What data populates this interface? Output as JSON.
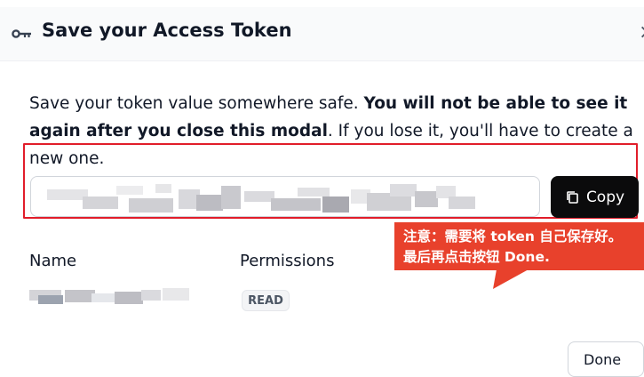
{
  "modal": {
    "title": "Save your Access Token",
    "key_icon": "key-icon",
    "close_icon": "close-icon",
    "close_glyph": "×"
  },
  "description": {
    "text_start": "Save your token value somewhere safe. ",
    "bold": "You will not be able to see it again after you close this modal",
    "text_end": ". If you lose it, you'll have to create a new one."
  },
  "token": {
    "value_state": "blurred",
    "copy_label": "Copy",
    "copy_icon": "copy-icon"
  },
  "annotation": {
    "line1": "注意：需要将 token 自己保存好。",
    "line2": "最后再点击按钮 Done.",
    "box_color": "#e11d2a",
    "callout_color": "#e8412c"
  },
  "table": {
    "name_header": "Name",
    "permissions_header": "Permissions",
    "name_value_state": "blurred",
    "permission_badge": "READ"
  },
  "footer": {
    "done_label": "Done"
  }
}
